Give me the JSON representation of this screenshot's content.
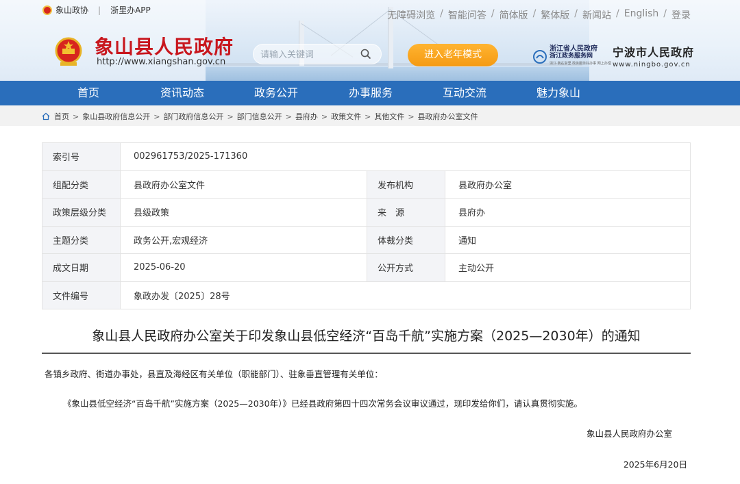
{
  "top_bar": {
    "left_site": "象山政协",
    "left_app": "浙里办APP",
    "links": [
      "无障碍浏览",
      "智能问答",
      "简体版",
      "繁体版",
      "新闻站",
      "English",
      "登录"
    ]
  },
  "header": {
    "title": "象山县人民政府",
    "url": "http://www.xiangshan.gov.cn",
    "search_placeholder": "请输入关键词",
    "elder_mode": "进入老年模式",
    "zj_line1": "浙江省人民政府",
    "zj_line2": "浙江政务服务网",
    "zj_line3": "浙江·我在浙里 政务服务好办事 网上办理",
    "nb_name": "宁波市人民政府",
    "nb_url": "www.ningbo.gov.cn"
  },
  "nav": [
    "首页",
    "资讯动态",
    "政务公开",
    "办事服务",
    "互动交流",
    "魅力象山"
  ],
  "breadcrumb": [
    "首页",
    "象山县政府信息公开",
    "部门政府信息公开",
    "部门信息公开",
    "县府办",
    "政策文件",
    "其他文件",
    "县政府办公室文件"
  ],
  "info": {
    "index_label": "索引号",
    "index_value": "002961753/2025-171360",
    "category_label": "组配分类",
    "category_value": "县政府办公室文件",
    "publisher_label": "发布机构",
    "publisher_value": "县政府办公室",
    "level_label": "政策层级分类",
    "level_value": "县级政策",
    "source_label": "来　源",
    "source_value": "县府办",
    "topic_label": "主题分类",
    "topic_value": "政务公开,宏观经济",
    "genre_label": "体裁分类",
    "genre_value": "通知",
    "date_label": "成文日期",
    "date_value": "2025-06-20",
    "open_label": "公开方式",
    "open_value": "主动公开",
    "docno_label": "文件编号",
    "docno_value": "象政办发〔2025〕28号"
  },
  "article": {
    "title": "象山县人民政府办公室关于印发象山县低空经济“百岛千航”实施方案（2025—2030年）的通知",
    "salutation": "各镇乡政府、街道办事处，县直及海经区有关单位（职能部门）、驻象垂直管理有关单位：",
    "body": "《象山县低空经济“百岛千航”实施方案（2025—2030年）》已经县政府第四十四次常务会议审议通过，现印发给你们，请认真贯彻实施。",
    "signature": "象山县人民政府办公室",
    "date": "2025年6月20日"
  },
  "colors": {
    "nav": "#2a6ebb",
    "title_red": "#c8161d",
    "elder_orange": "#f59a12"
  }
}
